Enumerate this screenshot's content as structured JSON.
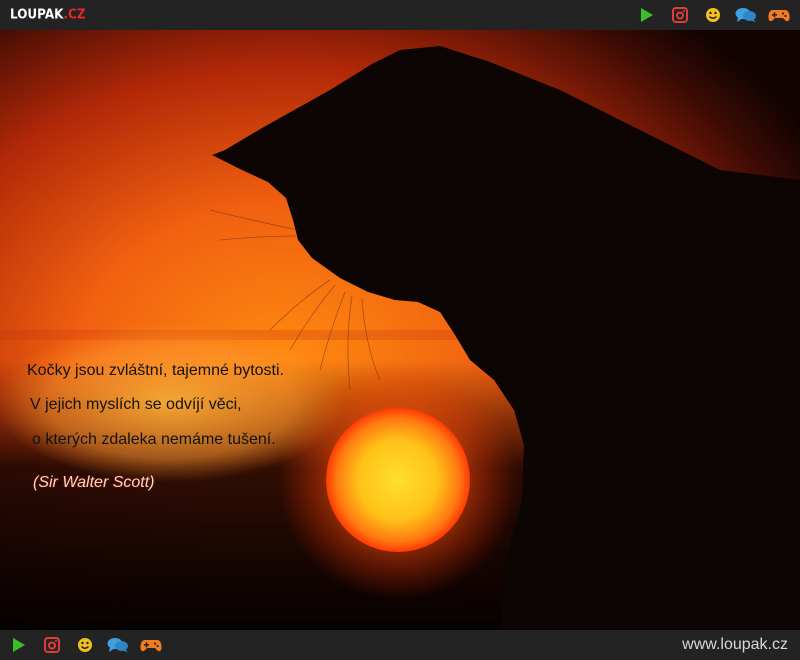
{
  "header": {
    "logo_main": "LOUPAK",
    "logo_suffix": ".CZ",
    "icons": [
      "play-icon",
      "instagram-icon",
      "smiley-icon",
      "chat-icon",
      "gamepad-icon"
    ]
  },
  "quote": {
    "lines": [
      "Kočky jsou zvláštní, tajemné bytosti.",
      "V jejich myslích se odvíjí věci,",
      "o kterých zdaleka nemáme tušení."
    ],
    "author": "(Sir Walter Scott)"
  },
  "footer": {
    "icons": [
      "play-icon",
      "instagram-icon",
      "smiley-icon",
      "chat-icon",
      "gamepad-icon"
    ],
    "site_url": "www.loupak.cz"
  },
  "colors": {
    "bar": "#232323",
    "play": "#3dbd2a",
    "instagram": "#e03c3c",
    "smiley": "#f2c01e",
    "chat": "#3fa0e0",
    "gamepad": "#f47c20",
    "sun": "#ffd21c"
  }
}
